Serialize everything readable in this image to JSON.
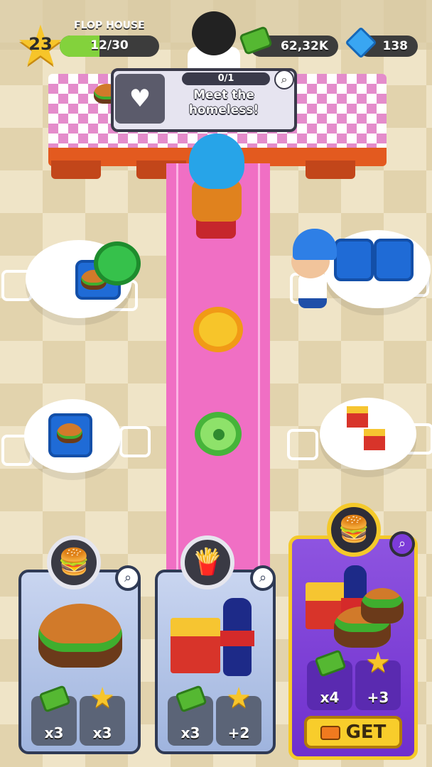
{
  "hud": {
    "level": "23",
    "restaurant_name": "FLOP HOUSE",
    "xp_text": "12/30",
    "xp_progress": 0.4,
    "cash": "62,32K",
    "gems": "138"
  },
  "task": {
    "progress_text": "0/1",
    "progress": 0,
    "title": "Meet the\nhomeless!"
  },
  "offers": [
    {
      "name": "burger",
      "stat1": "x3",
      "stat2": "x3"
    },
    {
      "name": "fries-cola",
      "stat1": "x3",
      "stat2": "+2"
    },
    {
      "name": "combo",
      "stat1": "x4",
      "stat2": "+3",
      "button": "GET"
    }
  ],
  "colors": {
    "carpet": "#f06fc4",
    "xp": "#83d23c",
    "card_purple": "#7c3bd8",
    "card_border_gold": "#f4c92a"
  }
}
